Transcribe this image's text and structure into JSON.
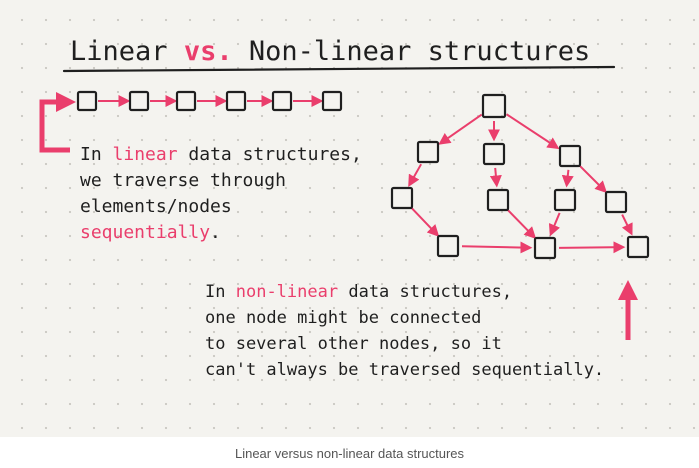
{
  "title": {
    "part1": "Linear",
    "vs": "vs.",
    "part2": "Non-linear structures"
  },
  "linear_note": {
    "line1_a": "In",
    "line1_hl": "linear",
    "line1_b": "data structures,",
    "line2": "we traverse through",
    "line3": "elements/nodes",
    "line4_hl": "sequentially",
    "line4_b": "."
  },
  "nonlinear_note": {
    "line1_a": "In",
    "line1_hl": "non-linear",
    "line1_b": "data structures,",
    "line2": "one node might be connected",
    "line3": "to several other nodes, so it",
    "line4": "can't always be traversed sequentially."
  },
  "caption": "Linear versus non-linear data structures",
  "colors": {
    "ink": "#1f1f1f",
    "accent_pink": "#ea3e6c",
    "paper": "#f4f3ef",
    "caption": "#555555"
  }
}
